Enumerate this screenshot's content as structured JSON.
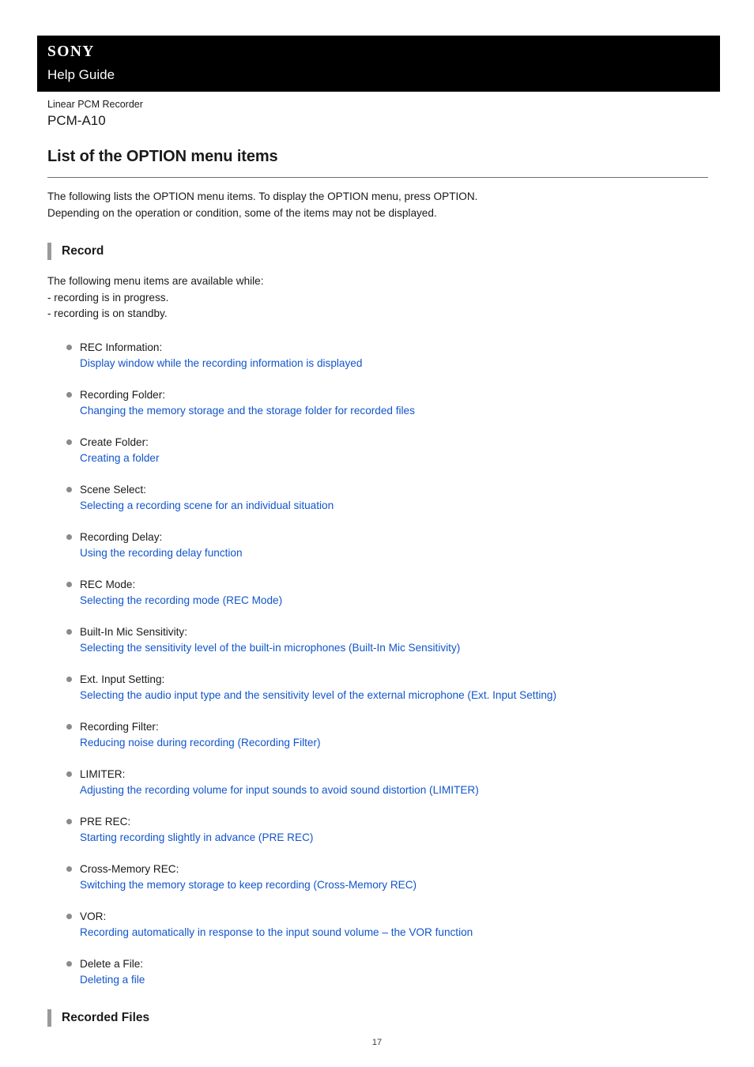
{
  "header": {
    "brand": "SONY",
    "guide_title": "Help Guide"
  },
  "product": {
    "category": "Linear PCM Recorder",
    "model": "PCM-A10"
  },
  "page": {
    "title": "List of the OPTION menu items",
    "intro_line_1": "The following lists the OPTION menu items. To display the OPTION menu, press OPTION.",
    "intro_line_2": "Depending on the operation or condition, some of the items may not be displayed.",
    "page_number": "17"
  },
  "sections": [
    {
      "heading": "Record",
      "note_line_1": "The following menu items are available while:",
      "note_line_2": "- recording is in progress.",
      "note_line_3": "- recording is on standby.",
      "items": [
        {
          "label": "REC Information:",
          "link": "Display window while the recording information is displayed"
        },
        {
          "label": "Recording Folder:",
          "link": "Changing the memory storage and the storage folder for recorded files"
        },
        {
          "label": "Create Folder:",
          "link": "Creating a folder"
        },
        {
          "label": "Scene Select:",
          "link": "Selecting a recording scene for an individual situation"
        },
        {
          "label": "Recording Delay:",
          "link": "Using the recording delay function"
        },
        {
          "label": "REC Mode:",
          "link": "Selecting the recording mode (REC Mode)"
        },
        {
          "label": "Built-In Mic Sensitivity:",
          "link": "Selecting the sensitivity level of the built-in microphones (Built-In Mic Sensitivity)"
        },
        {
          "label": "Ext. Input Setting:",
          "link": "Selecting the audio input type and the sensitivity level of the external microphone (Ext. Input Setting)"
        },
        {
          "label": "Recording Filter:",
          "link": "Reducing noise during recording (Recording Filter)"
        },
        {
          "label": "LIMITER:",
          "link": "Adjusting the recording volume for input sounds to avoid sound distortion (LIMITER)"
        },
        {
          "label": "PRE REC:",
          "link": "Starting recording slightly in advance (PRE REC)"
        },
        {
          "label": "Cross-Memory REC:",
          "link": "Switching the memory storage to keep recording (Cross-Memory REC)"
        },
        {
          "label": "VOR:",
          "link": "Recording automatically in response to the input sound volume – the VOR function"
        },
        {
          "label": "Delete a File:",
          "link": "Deleting a file"
        }
      ]
    },
    {
      "heading": "Recorded Files",
      "items": []
    }
  ],
  "colors": {
    "link": "#1155cc",
    "masthead_bg": "#000000",
    "bullet": "#8a8a8a",
    "section_bar": "#9a9a9a",
    "rule": "#707070"
  }
}
